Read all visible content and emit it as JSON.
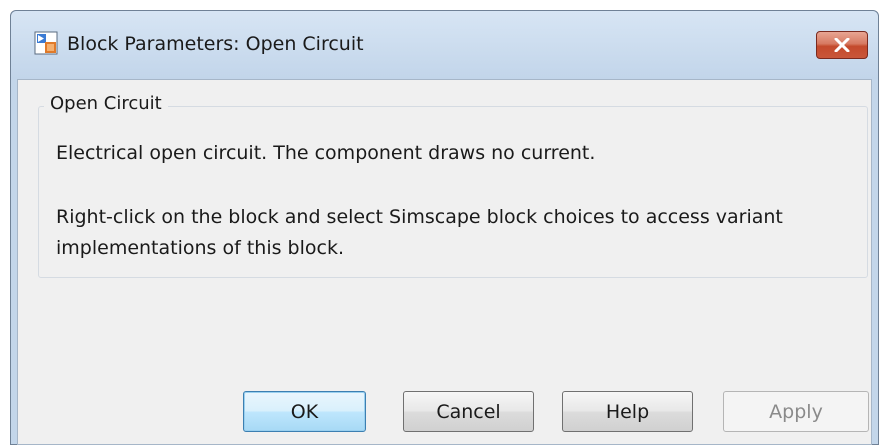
{
  "window": {
    "title": "Block Parameters: Open Circuit",
    "app_icon": "simulink-block-icon",
    "close_icon": "close-x-icon"
  },
  "group": {
    "title": "Open Circuit",
    "description_line1": "Electrical open circuit. The component draws no current.",
    "description_line2": "Right-click on the block and select Simscape block choices to access variant implementations of this block."
  },
  "buttons": {
    "ok": "OK",
    "cancel": "Cancel",
    "help": "Help",
    "apply": "Apply"
  },
  "colors": {
    "close_button": "#c44a2c",
    "titlebar": "#c2d5ea",
    "client_background": "#f0f0f0",
    "default_button_border": "#3c7fb1"
  }
}
